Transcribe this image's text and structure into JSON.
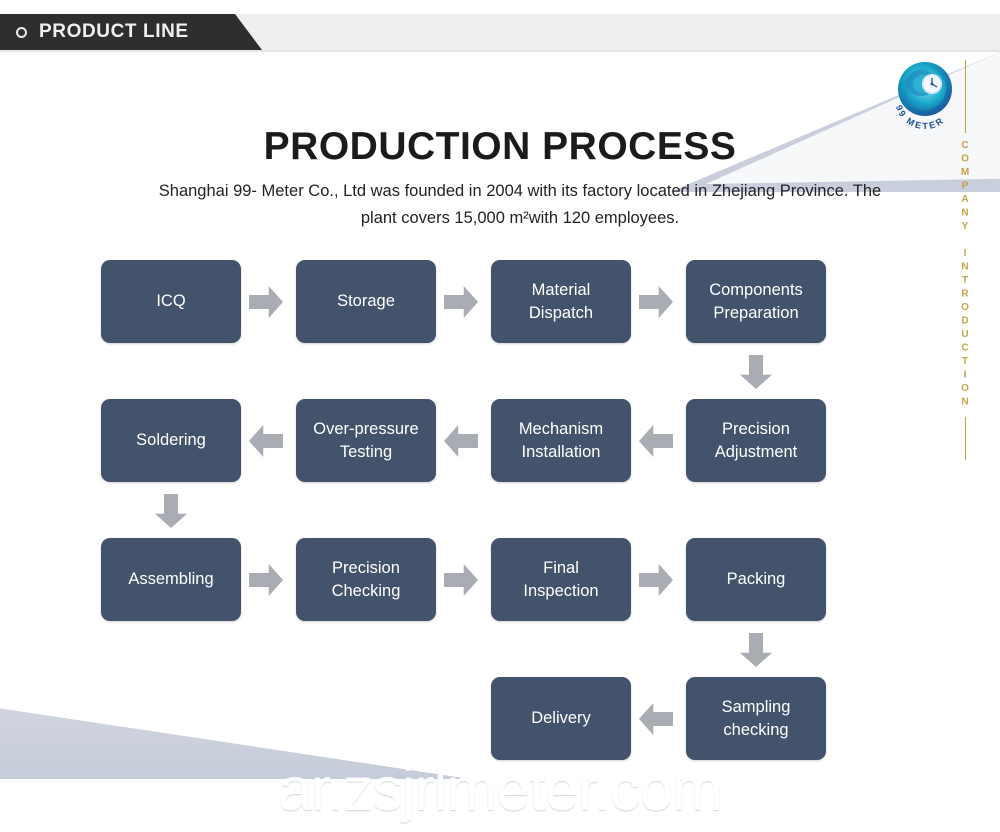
{
  "banner": {
    "label": "PRODUCT LINE",
    "bullet_icon": "circle-outline-icon",
    "bg_color": "#2e2e2e",
    "strip_color": "#efefef"
  },
  "logo": {
    "name": "99-meter-logo",
    "brand_text": "99 METER",
    "colors": [
      "#1a5fa8",
      "#16a6c4",
      "#0d7fa8",
      "#2bbfd4"
    ]
  },
  "rail": {
    "text": "COMPANY INTRODUCTION",
    "color": "#c9a34a"
  },
  "heading": {
    "title": "PRODUCTION PROCESS",
    "subtitle": "Shanghai 99- Meter Co., Ltd was founded in 2004 with its factory located in Zhejiang Province. The plant covers 15,000 m²with 120 employees."
  },
  "theme": {
    "node_color": "#43536b",
    "node_text_color": "#ffffff",
    "arrow_color": "#a9acb3",
    "wedge_color": "#c9cedc"
  },
  "flow": {
    "rows": [
      {
        "direction": "right",
        "nodes": [
          "ICQ",
          "Storage",
          "Material Dispatch",
          "Components Preparation"
        ]
      },
      {
        "direction": "left",
        "nodes": [
          "Soldering",
          "Over-pressure Testing",
          "Mechanism Installation",
          "Precision Adjustment"
        ]
      },
      {
        "direction": "right",
        "nodes": [
          "Assembling",
          "Precision Checking",
          "Final Inspection",
          "Packing"
        ]
      },
      {
        "direction": "left",
        "nodes": [
          "Delivery",
          "Sampling checking"
        ]
      }
    ],
    "nodes": {
      "icq": "ICQ",
      "storage": "Storage",
      "material_dispatch": "Material\nDispatch",
      "components_preparation": "Components\nPreparation",
      "precision_adjustment": "Precision\nAdjustment",
      "mechanism_installation": "Mechanism\nInstallation",
      "overpressure_testing": "Over-pressure\nTesting",
      "soldering": "Soldering",
      "assembling": "Assembling",
      "precision_checking": "Precision\nChecking",
      "final_inspection": "Final\nInspection",
      "packing": "Packing",
      "sampling_checking": "Sampling\nchecking",
      "delivery": "Delivery"
    }
  },
  "watermark": {
    "text": "ar.zsjrlmeter.com"
  }
}
